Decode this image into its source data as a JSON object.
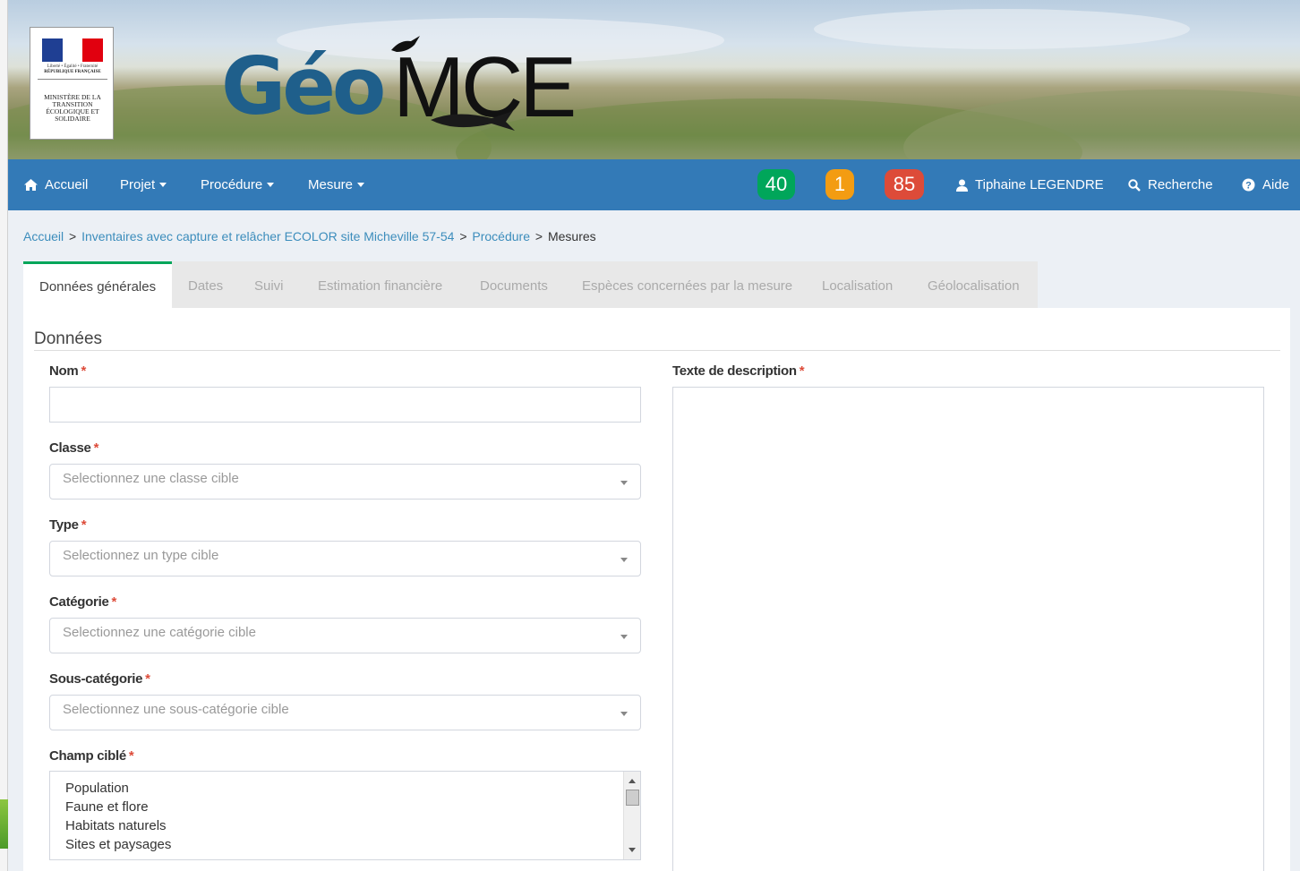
{
  "ministry": {
    "devise": "Liberté • Égalité • Fraternité",
    "republique": "RÉPUBLIQUE FRANÇAISE",
    "name": "MINISTÈRE DE LA TRANSITION ÉCOLOGIQUE ET SOLIDAIRE"
  },
  "logo": {
    "part1": "Géo",
    "part2": "MCE"
  },
  "navbar": {
    "home": "Accueil",
    "projet": "Projet",
    "procedure": "Procédure",
    "mesure": "Mesure",
    "badges": [
      {
        "value": "40",
        "color": "#00a65a"
      },
      {
        "value": "1",
        "color": "#f39c12"
      },
      {
        "value": "85",
        "color": "#dd4b39"
      }
    ],
    "user": "Tiphaine LEGENDRE",
    "search": "Recherche",
    "help": "Aide"
  },
  "breadcrumb": {
    "home": "Accueil",
    "project": "Inventaires avec capture et relâcher ECOLOR site Micheville 57-54",
    "procedure": "Procédure",
    "current": "Mesures",
    "separator": ">"
  },
  "tabs": [
    {
      "label": "Données générales",
      "active": true
    },
    {
      "label": "Dates"
    },
    {
      "label": "Suivi"
    },
    {
      "label": "Estimation financière"
    },
    {
      "label": "Documents"
    },
    {
      "label": "Espèces concernées par la mesure"
    },
    {
      "label": "Localisation"
    },
    {
      "label": "Géolocalisation"
    }
  ],
  "form": {
    "section_title": "Données",
    "required_mark": "*",
    "nom": {
      "label": "Nom",
      "value": ""
    },
    "classe": {
      "label": "Classe",
      "placeholder": "Selectionnez une classe cible"
    },
    "type": {
      "label": "Type",
      "placeholder": "Selectionnez un type cible"
    },
    "categorie": {
      "label": "Catégorie",
      "placeholder": "Selectionnez une catégorie cible"
    },
    "sous_categorie": {
      "label": "Sous-catégorie",
      "placeholder": "Selectionnez une sous-catégorie cible"
    },
    "champ_cible": {
      "label": "Champ ciblé",
      "options": [
        "Population",
        "Faune et flore",
        "Habitats naturels",
        "Sites et paysages"
      ]
    },
    "description": {
      "label": "Texte de description",
      "value": ""
    }
  },
  "colors": {
    "navbar": "#337ab7",
    "link": "#3c8dbc",
    "required": "#dd4b39",
    "active_tab_border": "#00a65a"
  }
}
